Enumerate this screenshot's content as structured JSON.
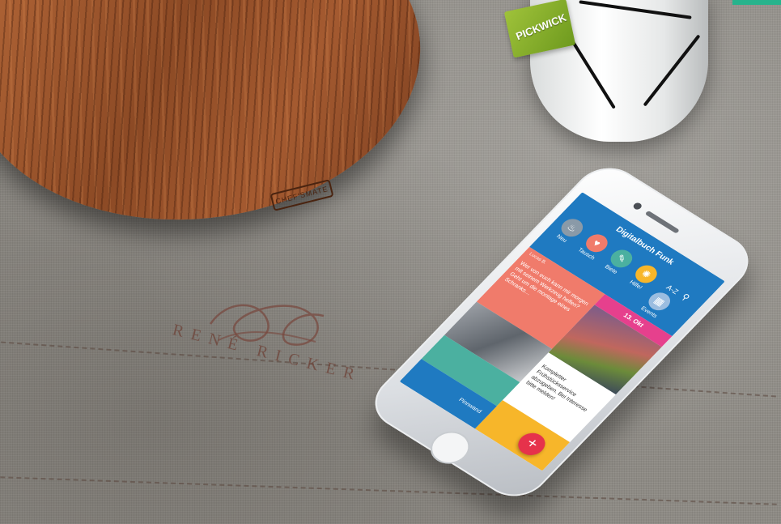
{
  "board": {
    "brand": "CHEF'SMATE"
  },
  "mug": {
    "tea_brand": "PICKWICK"
  },
  "embroidery": {
    "brand": "RENÉ RICKER"
  },
  "app": {
    "title": "Digitalbuch Funk",
    "nav": [
      {
        "label": "Neu",
        "icon": "pot-icon",
        "color": "#8a9aa8"
      },
      {
        "label": "Tausch",
        "icon": "heart-icon",
        "color": "#f07b6b"
      },
      {
        "label": "Biete",
        "icon": "pencil-icon",
        "color": "#4bb0a0"
      },
      {
        "label": "Hilfe!",
        "icon": "lifebuoy-icon",
        "color": "#f7b62a"
      },
      {
        "label": "Events",
        "icon": "calendar-icon",
        "color": "#9bbde0"
      }
    ],
    "sort_icon": "A-Z",
    "search_icon": "⚲",
    "card1": {
      "author": "Lucas B.",
      "text": "Wer von euch kann mir morgen mit seinem Werkzeug helfen? Geht um die montage eines Schranks…"
    },
    "event": {
      "label": "13. Okt"
    },
    "card2": {
      "text": "Kompletter Frühstücksservice abzugeben. Bei Interesse bitte melden!"
    },
    "bottom": {
      "label": "Pinnwand"
    },
    "fab": "+"
  }
}
